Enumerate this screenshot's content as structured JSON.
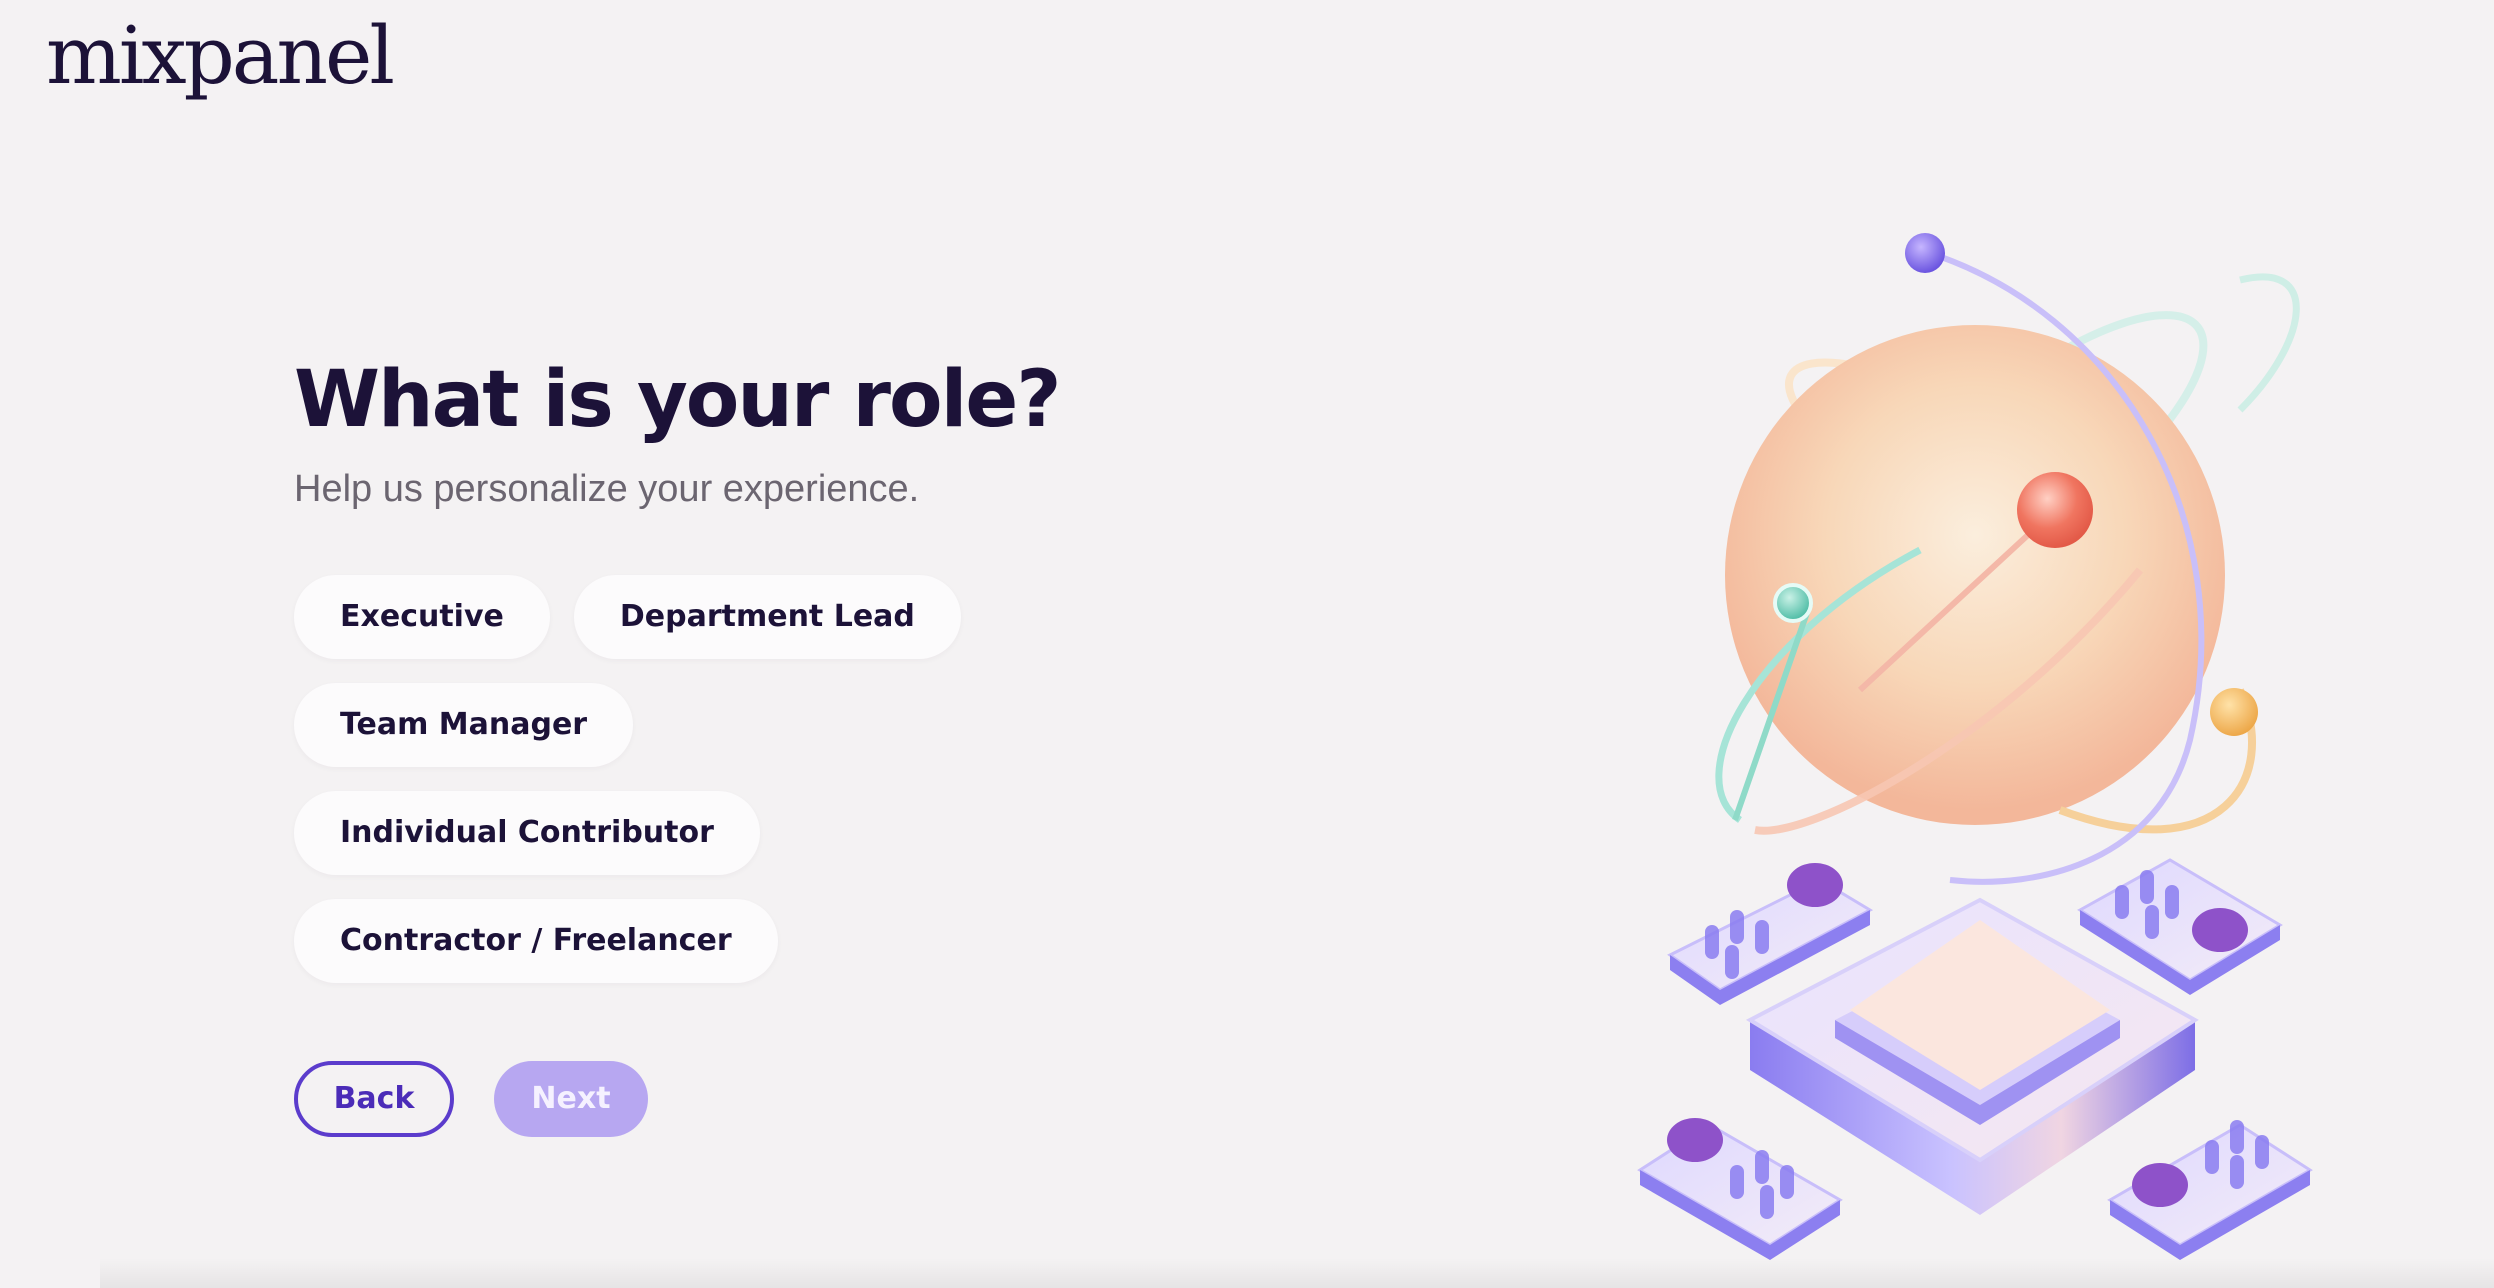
{
  "brand": {
    "logo_text": "mixpanel"
  },
  "main": {
    "title": "What is your role?",
    "subtitle": "Help us personalize your experience.",
    "roles": [
      {
        "label": "Executive"
      },
      {
        "label": "Department Lead"
      },
      {
        "label": "Team Manager"
      },
      {
        "label": "Individual Contributor"
      },
      {
        "label": "Contractor / Freelancer"
      }
    ]
  },
  "actions": {
    "back_label": "Back",
    "next_label": "Next"
  },
  "colors": {
    "primary_text": "#1c1238",
    "accent": "#5b3ccc",
    "next_disabled": "#b7a7f1",
    "background": "#f4f2f3"
  }
}
